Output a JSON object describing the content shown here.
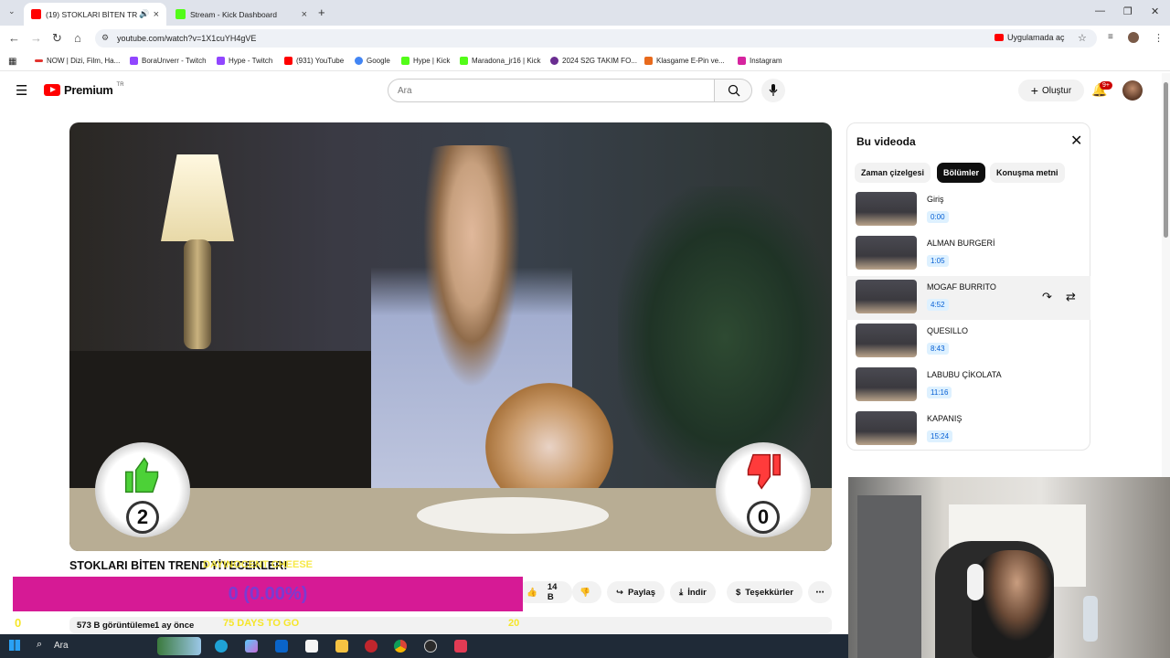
{
  "browser": {
    "tabs": [
      {
        "label": "(19) STOKLARI BİTEN TREN",
        "active": true
      },
      {
        "label": "Stream - Kick Dashboard",
        "active": false
      }
    ],
    "url": "youtube.com/watch?v=1X1cuYH4gVE",
    "open_in_app": "Uygulamada aç",
    "bookmarks": [
      "NOW | Dizi, Film, Ha...",
      "BoraUnverr - Twitch",
      "Hype - Twitch",
      "(931) YouTube",
      "Google",
      "Hype | Kick",
      "Maradona_jr16 | Kick",
      "2024 S2G TAKIM FO...",
      "Klasgame E-Pin ve...",
      "Instagram"
    ]
  },
  "header": {
    "logo_text": "Premium",
    "logo_region": "TR",
    "search_placeholder": "Ara",
    "create_label": "Oluştur",
    "notif_count": "9+"
  },
  "video": {
    "like_count_overlay": "2",
    "dislike_count_overlay": "0",
    "title": "STOKLARI BİTEN TREND YİYECEKLER!",
    "likes": "14 B",
    "share": "Paylaş",
    "download": "İndir",
    "thanks": "Teşekkürler",
    "views": "573 B görüntüleme",
    "age": "1 ay önce"
  },
  "panel": {
    "title": "Bu videoda",
    "chips": [
      "Zaman çizelgesi",
      "Bölümler",
      "Konuşma metni"
    ],
    "selected_chip": "Bölümler",
    "chapters": [
      {
        "title": "Giriş",
        "time": "0:00"
      },
      {
        "title": "ALMAN BURGERİ",
        "time": "1:05"
      },
      {
        "title": "MOGAF BURRITO",
        "time": "4:52"
      },
      {
        "title": "QUESILLO",
        "time": "8:43"
      },
      {
        "title": "LABUBU ÇİKOLATA",
        "time": "11:16"
      },
      {
        "title": "KAPANIŞ",
        "time": "15:24"
      }
    ]
  },
  "overlay": {
    "goal_text": "0 (0.00%)",
    "goal_min": "0",
    "goal_max": "20",
    "days_text": "75 DAYS TO GO",
    "ticker": "DAYINOCENT CHEESE"
  },
  "taskbar": {
    "search_label": "Ara"
  },
  "colors": {
    "yt_red": "#ff0000",
    "goal_bar": "#d61a95",
    "goal_text": "#7b3bd1",
    "overlay_yellow": "#f6e62a",
    "link_blue": "#065fd4"
  }
}
